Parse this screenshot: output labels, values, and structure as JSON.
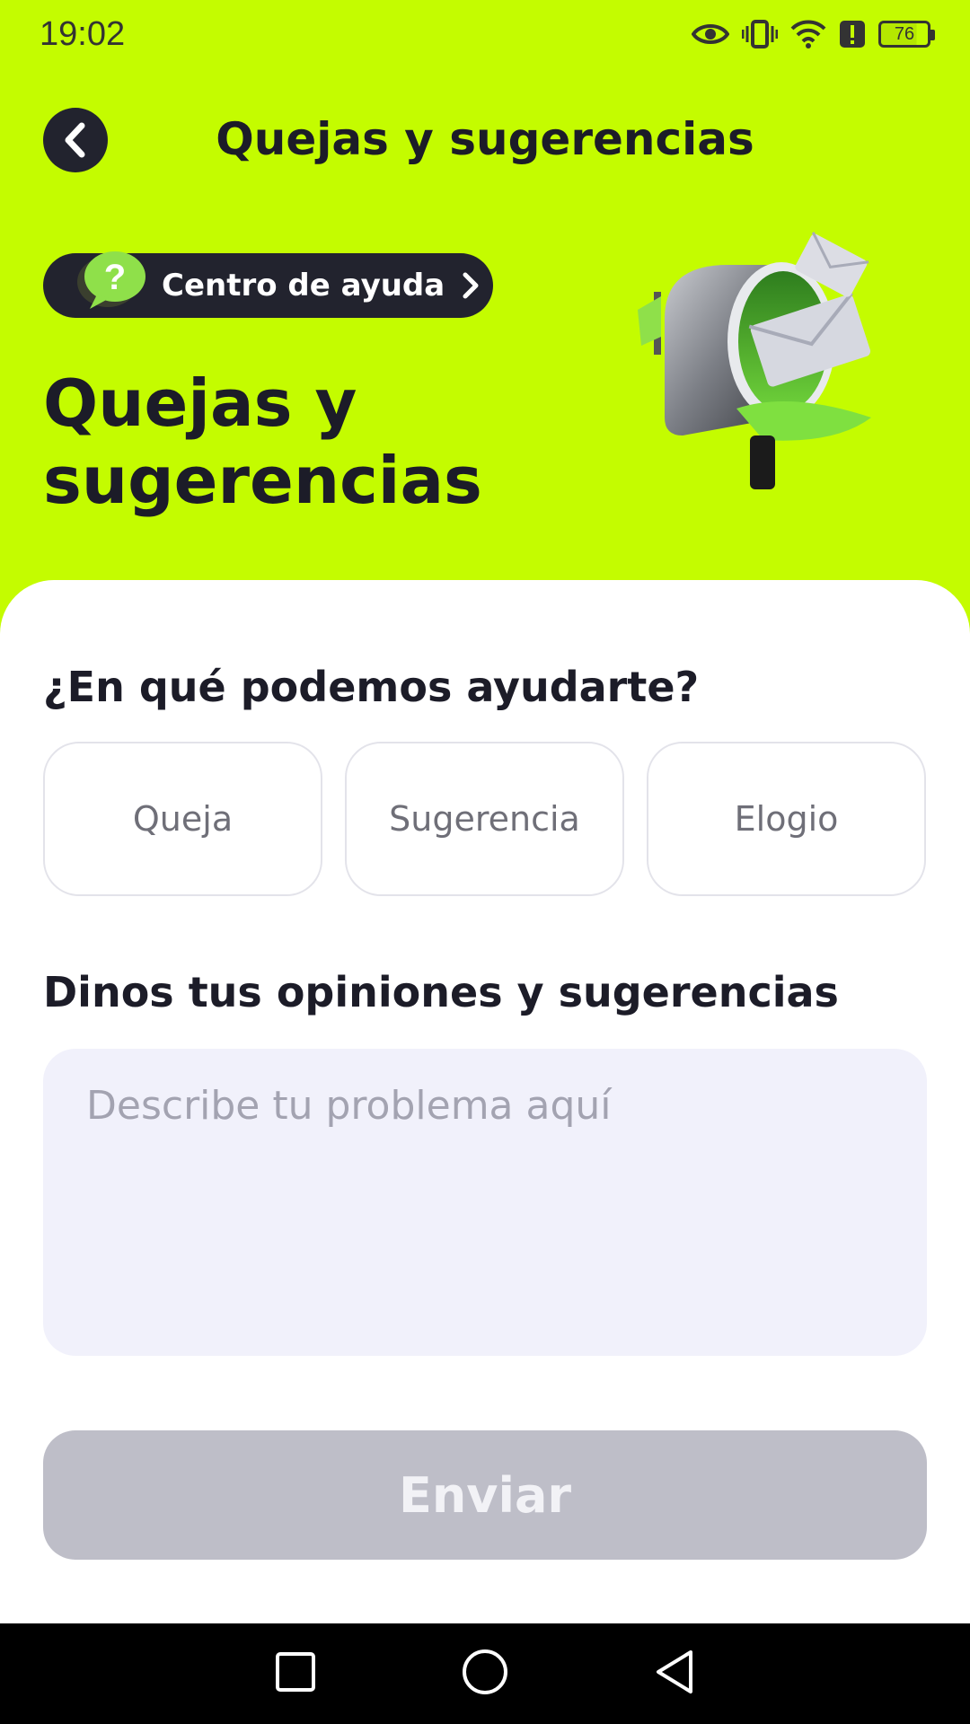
{
  "status_bar": {
    "time": "19:02",
    "battery_level": "76",
    "icons": [
      "eye-icon",
      "vibrate-icon",
      "wifi-icon",
      "alert-icon",
      "battery-icon"
    ]
  },
  "header": {
    "back_icon": "chevron-left-icon",
    "title": "Quejas y sugerencias"
  },
  "hero": {
    "help_center_label": "Centro de ayuda",
    "title_line1": "Quejas y",
    "title_line2": "sugerencias",
    "illustration": "mailbox-illustration"
  },
  "form": {
    "question": "¿En qué podemos ayudarte?",
    "options": [
      "Queja",
      "Sugerencia",
      "Elogio"
    ],
    "opinions_label": "Dinos tus opiniones y sugerencias",
    "placeholder": "Describe tu problema aquí",
    "value": "",
    "submit_label": "Enviar"
  },
  "colors": {
    "accent": "#c4fc00",
    "dark": "#22232e",
    "button_disabled": "#bebec8",
    "input_bg": "#f1f1fb"
  },
  "nav_bar": {
    "icons": [
      "recent-apps-icon",
      "home-icon",
      "back-icon"
    ]
  }
}
